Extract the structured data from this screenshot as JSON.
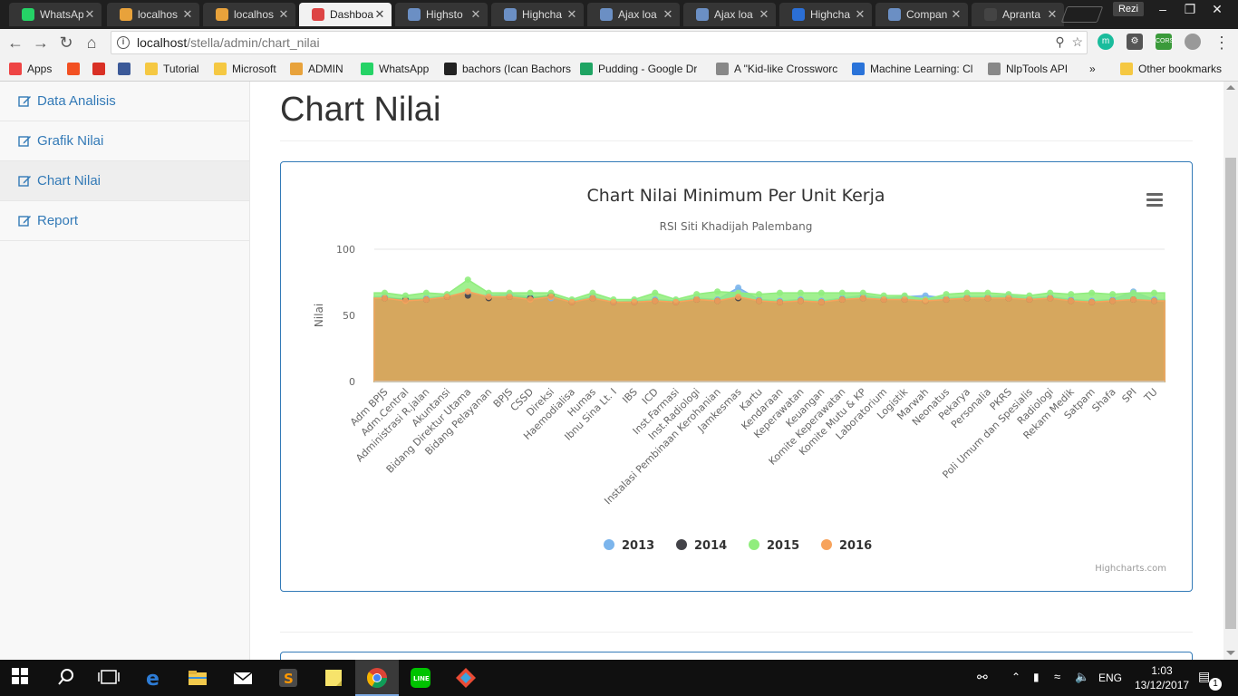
{
  "browser": {
    "tabs": [
      {
        "label": "WhatsAp",
        "color": "#25d366"
      },
      {
        "label": "localhos",
        "color": "#e8a23b"
      },
      {
        "label": "localhos",
        "color": "#e8a23b"
      },
      {
        "label": "Dashboa",
        "color": "#d44",
        "active": true
      },
      {
        "label": "Highsto",
        "color": "#6b8fc4"
      },
      {
        "label": "Highcha",
        "color": "#6b8fc4"
      },
      {
        "label": "Ajax loa",
        "color": "#6b8fc4"
      },
      {
        "label": "Ajax loa",
        "color": "#6b8fc4"
      },
      {
        "label": "Highcha",
        "color": "#2b6fd6"
      },
      {
        "label": "Compan",
        "color": "#6b8fc4"
      },
      {
        "label": "Apranta",
        "color": "#444"
      }
    ],
    "profile": "Rezi",
    "url_host": "localhost",
    "url_path": "/stella/admin/chart_nilai",
    "bookmarks": [
      {
        "label": "Apps",
        "color": "#e44"
      },
      {
        "label": "",
        "color": "#f25022"
      },
      {
        "label": "",
        "color": "#d93025"
      },
      {
        "label": "",
        "color": "#3b5998"
      },
      {
        "label": "Tutorial",
        "color": "#f5c842"
      },
      {
        "label": "Microsoft",
        "color": "#f5c842"
      },
      {
        "label": "ADMIN",
        "color": "#e8a23b"
      },
      {
        "label": "WhatsApp",
        "color": "#25d366"
      },
      {
        "label": "bachors (Ican Bachors",
        "color": "#222"
      },
      {
        "label": "Pudding - Google Dr",
        "color": "#1fa463"
      },
      {
        "label": "A \"Kid-like Crossworc",
        "color": "#888"
      },
      {
        "label": "Machine Learning: Cl",
        "color": "#2a73d9"
      },
      {
        "label": "NlpTools API",
        "color": "#888"
      },
      {
        "label": "»",
        "color": ""
      },
      {
        "label": "Other bookmarks",
        "color": "#f5c842"
      }
    ]
  },
  "sidebar": {
    "items": [
      {
        "label": "Data Analisis",
        "active": false
      },
      {
        "label": "Grafik Nilai",
        "active": false
      },
      {
        "label": "Chart Nilai",
        "active": true
      },
      {
        "label": "Report",
        "active": false
      }
    ]
  },
  "page": {
    "title": "Chart Nilai"
  },
  "chart_data": {
    "type": "area",
    "title": "Chart Nilai Minimum Per Unit Kerja",
    "subtitle": "RSI Siti Khadijah Palembang",
    "ylabel": "Nilai",
    "xlabel": "",
    "ylim": [
      0,
      100
    ],
    "yticks": [
      0,
      50,
      100
    ],
    "grid": true,
    "legend_position": "bottom",
    "credits": "Highcharts.com",
    "categories": [
      "Adm BPJS",
      "Adm.Central",
      "Administrasi R.jalan",
      "Akuntansi",
      "Bidang Direktur Utama",
      "Bidang Pelayanan",
      "BPJS",
      "CSSD",
      "Direksi",
      "Haemodialisa",
      "Humas",
      "Ibnu Sina Lt. I",
      "IBS",
      "ICD",
      "Inst.Farmasi",
      "Inst.Radiologi",
      "Instalasi Pembinaan Kerohanian",
      "Jamkesmas",
      "Kartu",
      "Kendaraan",
      "Keperawatan",
      "Keuangan",
      "Komite Keperawatan",
      "Komite Mutu & KP",
      "Laboratorium",
      "Logistik",
      "Marwah",
      "Neonatus",
      "Pekarya",
      "Personalia",
      "PKRS",
      "Poli Umum dan Spesialis",
      "Radiologi",
      "Rekam Medik",
      "Satpam",
      "Shafa",
      "SPI",
      "TU"
    ],
    "series": [
      {
        "name": "2013",
        "color": "#7cb5ec",
        "values": [
          64,
          62,
          63,
          65,
          66,
          65,
          66,
          64,
          63,
          61,
          64,
          60,
          61,
          62,
          61,
          63,
          62,
          71,
          62,
          61,
          62,
          61,
          63,
          65,
          63,
          64,
          65,
          63,
          64,
          64,
          65,
          63,
          64,
          62,
          61,
          62,
          68,
          62
        ]
      },
      {
        "name": "2014",
        "color": "#434348",
        "values": [
          63,
          62,
          62,
          64,
          65,
          63,
          64,
          63,
          65,
          60,
          63,
          60,
          60,
          61,
          60,
          62,
          61,
          63,
          61,
          60,
          61,
          60,
          62,
          63,
          62,
          62,
          61,
          62,
          63,
          63,
          63,
          62,
          63,
          61,
          60,
          61,
          62,
          61
        ]
      },
      {
        "name": "2015",
        "color": "#90ed7d",
        "values": [
          67,
          65,
          67,
          66,
          77,
          67,
          67,
          67,
          67,
          62,
          67,
          62,
          62,
          67,
          62,
          66,
          68,
          67,
          66,
          67,
          67,
          67,
          67,
          67,
          65,
          65,
          62,
          66,
          67,
          67,
          66,
          65,
          67,
          66,
          67,
          66,
          67,
          67
        ]
      },
      {
        "name": "2016",
        "color": "#f7a35c",
        "values": [
          63,
          61,
          62,
          64,
          68,
          64,
          64,
          62,
          64,
          60,
          63,
          60,
          60,
          61,
          60,
          62,
          61,
          64,
          61,
          60,
          61,
          60,
          62,
          63,
          62,
          62,
          61,
          62,
          63,
          63,
          63,
          62,
          63,
          61,
          60,
          61,
          62,
          61
        ]
      }
    ]
  },
  "taskbar": {
    "language": "ENG",
    "time": "1:03",
    "date": "13/12/2017",
    "notifications": "1"
  }
}
